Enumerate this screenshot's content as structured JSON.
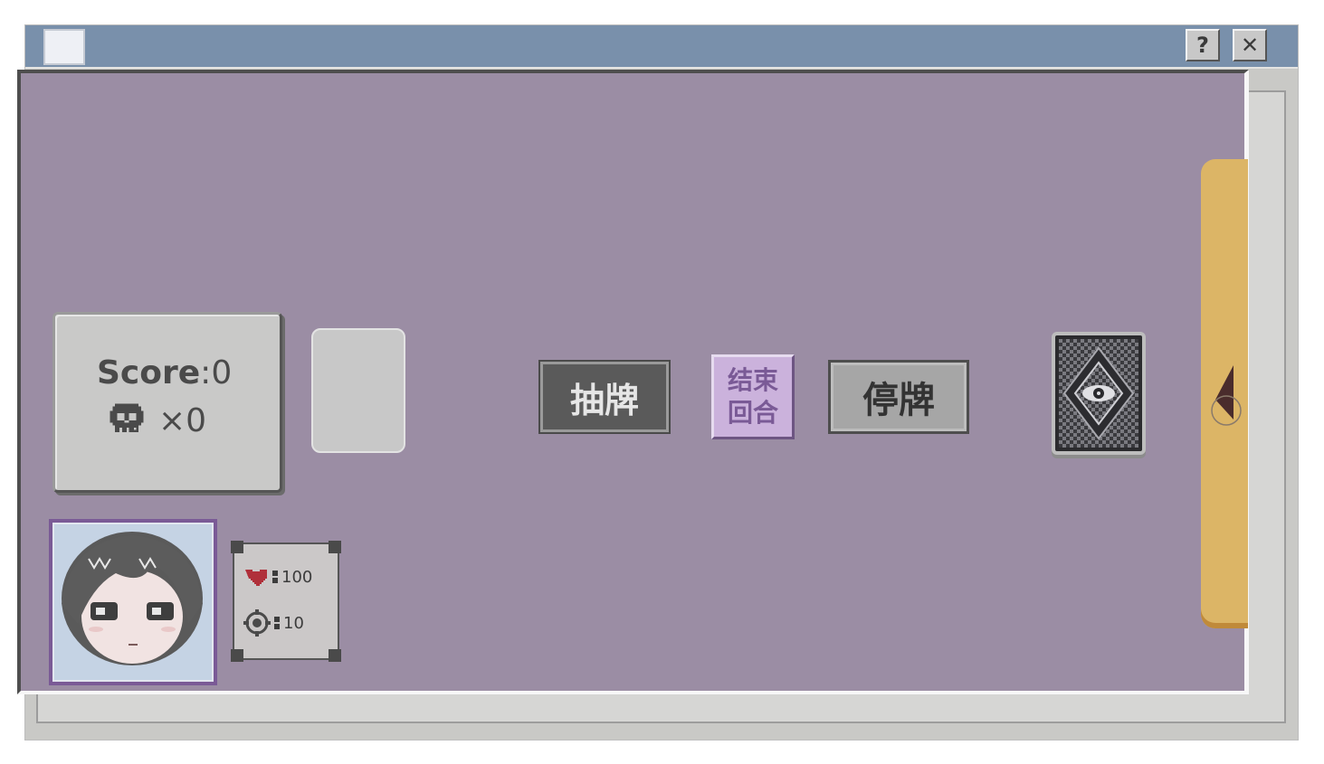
{
  "window": {
    "title_icon": "blank-window-icon",
    "help_label": "?",
    "close_label": "✕"
  },
  "score": {
    "label": "Score",
    "separator": ":",
    "value": "0",
    "skull_icon": "skull-icon",
    "multiplier": "×0"
  },
  "buttons": {
    "draw": "抽牌",
    "end_turn_line1": "结束",
    "end_turn_line2": "回合",
    "stand": "停牌"
  },
  "deck": {
    "icon": "eye-card-back"
  },
  "player": {
    "avatar": "girl-portrait",
    "hp_icon": "heart-icon",
    "hp": "100",
    "target_icon": "crosshair-icon",
    "target": "10"
  },
  "colors": {
    "table": "#9b8da4",
    "titlebar": "#7990ab",
    "accent_purple": "#7a5a96",
    "side_tab": "#dcb566",
    "heart": "#b0303a"
  }
}
